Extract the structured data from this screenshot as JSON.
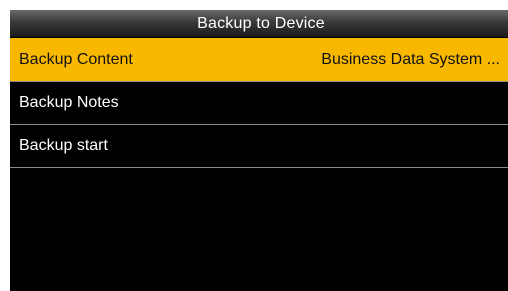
{
  "header": {
    "title": "Backup to Device"
  },
  "menu": {
    "items": [
      {
        "label": "Backup Content",
        "value": "Business Data System ..."
      },
      {
        "label": "Backup Notes",
        "value": ""
      },
      {
        "label": "Backup start",
        "value": ""
      }
    ]
  },
  "colors": {
    "selected_highlight": "#f9b800",
    "background": "#000000",
    "divider": "#8c8c8c",
    "text": "#ffffff"
  }
}
